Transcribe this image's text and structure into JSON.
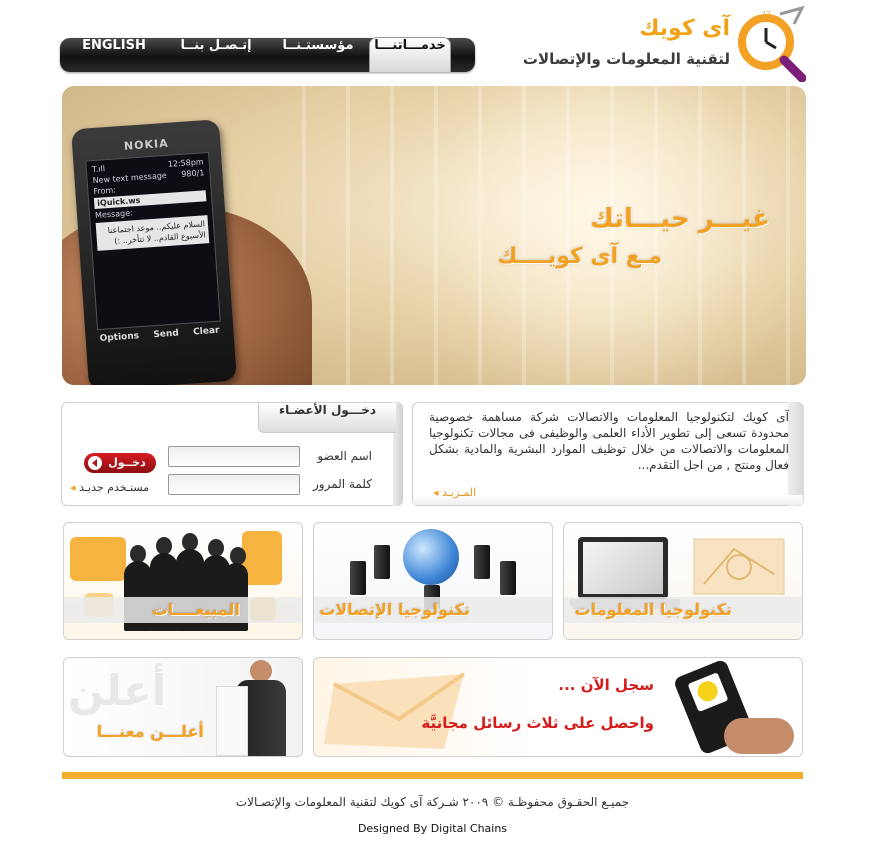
{
  "header": {
    "logo_name": "آى كويك",
    "logo_subtitle": "لتقنية المعلومات والإتصالات"
  },
  "nav": {
    "items": [
      {
        "label": "ENGLISH"
      },
      {
        "label": "إتـصـل بنــا"
      },
      {
        "label": "مؤسستـنــا"
      },
      {
        "label": "خدمـــاتنـــا"
      }
    ],
    "active_index": 3
  },
  "hero": {
    "line1": "غيـــر حيـــاتك",
    "line2": "مـع آى كويــــك",
    "phone": {
      "brand": "NOKIA",
      "status_left": "T.ıll",
      "time": "12:58pm",
      "heading": "New text message",
      "counter": "980/1",
      "from_label": "From:",
      "from_value": "iQuick.ws",
      "message_label": "Message:",
      "message": "السلام عليكم.. موعد اجتماعنا الأسبوع القادم.. لا تتأخر.. :)",
      "soft_left": "Options",
      "soft_mid": "Send",
      "soft_right": "Clear"
    }
  },
  "about": {
    "text": "آى كويك لتكنولوجيا المعلومات والاتصالات شركة مساهمة خصوصية محدودة تسعى إلى تطوير الأداء العلمى والوظيفى فى مجالات تكنولوجيا المعلومات والاتصالات من خلال توظيف الموارد البشرية والمادية بشكل فعال ومنتج , من اجل التقدم...",
    "more_label": "المـزيـد"
  },
  "login": {
    "title": "دخـــول الأعضـاء",
    "username_label": "اسم العضو",
    "password_label": "كلمة المرور",
    "username_value": "",
    "password_value": "",
    "submit_label": "دخــول",
    "new_user_label": "مستـخدم جديـد"
  },
  "cards": {
    "sales": "المبيعــــات",
    "telecom": "تكنولوجيا الإتصالات",
    "it": "تكنولوجيا المعلومات",
    "advertise_title": "أعلـــن معنـــا",
    "advertise_watermark": "أعلن",
    "signup_line1": "سجل الآن ...",
    "signup_line2": "واحصل على ثلاث رسائل مجانيَّة"
  },
  "footer": {
    "copyright": "جميـع الحقـوق محفوظـة © ٢٠٠٩ شـركة آى كويك لتقنية المعلومات والإتصـالات",
    "designed_by": "Designed By Digital Chains"
  },
  "colors": {
    "accent": "#f2a124",
    "footer_bar": "#f3ad2e",
    "login_button": "#b1151b",
    "nav_bg": "#1a1a1a"
  }
}
